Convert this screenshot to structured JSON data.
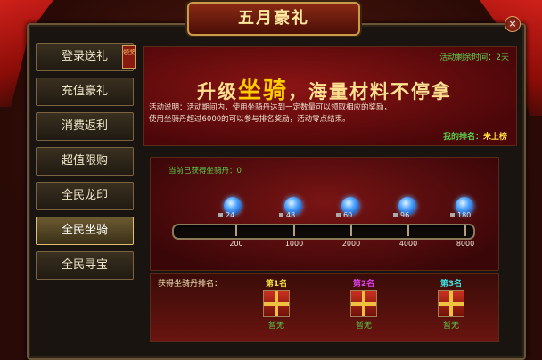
{
  "window": {
    "title": "五月豪礼",
    "close_icon": "×"
  },
  "sidebar": {
    "items": [
      {
        "label": "登录送礼",
        "badge": "领奖"
      },
      {
        "label": "充值豪礼"
      },
      {
        "label": "消费返利"
      },
      {
        "label": "超值限购"
      },
      {
        "label": "全民龙印"
      },
      {
        "label": "全民坐骑",
        "active": true
      },
      {
        "label": "全民寻宝"
      }
    ]
  },
  "banner": {
    "remaining": "活动剩余时间：2天",
    "slogan_pre": "升级",
    "slogan_em": "坐骑",
    "slogan_post": "，海量材料不停拿",
    "desc_line1": "活动说明：活动期间内，使用坐骑丹达到一定数量可以领取相应的奖励，",
    "desc_line2": "使用坐骑丹超过6000的可以参与排名奖励，活动零点结束。",
    "rank_label": "我的排名：",
    "rank_value": "未上榜"
  },
  "progress": {
    "obtained": "当前已获得坐骑丹：0",
    "fill_fraction": 0,
    "rewards": [
      {
        "count": "24",
        "threshold": "200"
      },
      {
        "count": "48",
        "threshold": "1000"
      },
      {
        "count": "60",
        "threshold": "2000"
      },
      {
        "count": "96",
        "threshold": "4000"
      },
      {
        "count": "180",
        "threshold": "8000"
      }
    ]
  },
  "ranking": {
    "title": "获得坐骑丹排名：",
    "slots": [
      {
        "title": "第1名",
        "status": "暂无",
        "color": "#f0e040"
      },
      {
        "title": "第2名",
        "status": "暂无",
        "color": "#e040f0"
      },
      {
        "title": "第3名",
        "status": "暂无",
        "color": "#40e0e0"
      }
    ]
  }
}
